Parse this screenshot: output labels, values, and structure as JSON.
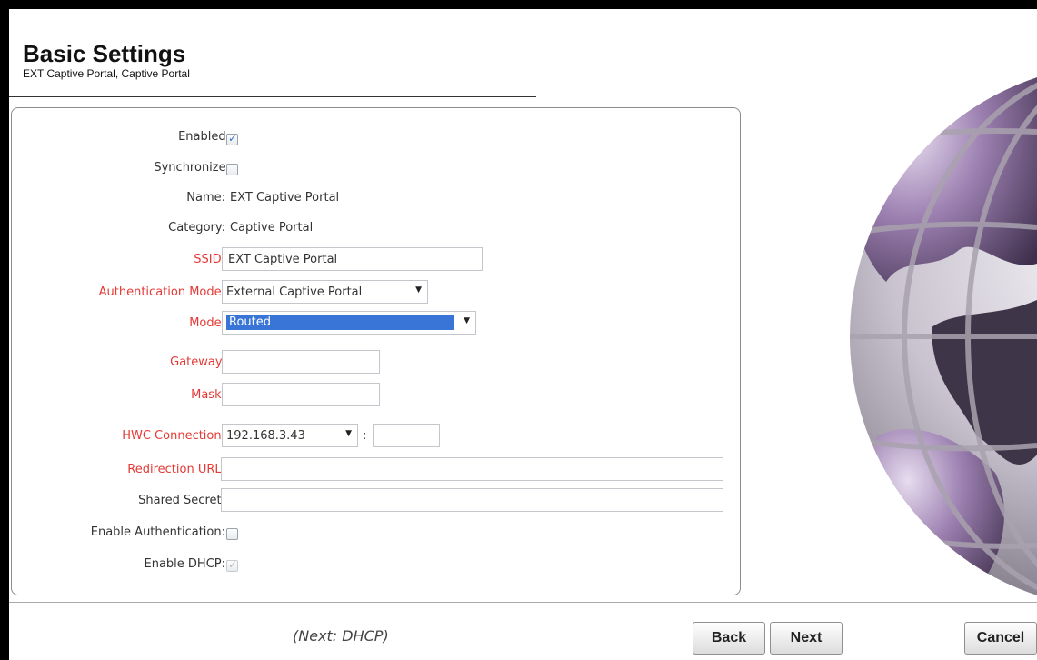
{
  "header": {
    "title": "Basic Settings",
    "subtitle": "EXT Captive Portal, Captive Portal"
  },
  "form": {
    "enabled": {
      "label": "Enabled:",
      "checked": true
    },
    "synchronize": {
      "label": "Synchronize:",
      "checked": false
    },
    "name": {
      "label": "Name:",
      "value": "EXT Captive Portal"
    },
    "category": {
      "label": "Category:",
      "value": "Captive Portal"
    },
    "ssid": {
      "label": "SSID:",
      "value": "EXT Captive Portal"
    },
    "auth_mode": {
      "label": "Authentication Mode:",
      "value": "External Captive Portal"
    },
    "mode": {
      "label": "Mode:",
      "value": "Routed"
    },
    "gateway": {
      "label": "Gateway:",
      "value": ""
    },
    "mask": {
      "label": "Mask:",
      "value": ""
    },
    "hwc_connection": {
      "label": "HWC Connection:",
      "value": "192.168.3.43",
      "separator": ":",
      "port": ""
    },
    "redirection_url": {
      "label": "Redirection URL:",
      "value": ""
    },
    "shared_secret": {
      "label": "Shared Secret:",
      "value": ""
    },
    "enable_authentication": {
      "label": "Enable Authentication:",
      "checked": false
    },
    "enable_dhcp": {
      "label": "Enable DHCP:",
      "checked": true,
      "disabled": true
    }
  },
  "footer": {
    "next_hint": "(Next: DHCP)",
    "back_label": "Back",
    "next_label": "Next",
    "cancel_label": "Cancel"
  },
  "colors": {
    "required_label": "#e53935",
    "selection": "#3875d7"
  }
}
